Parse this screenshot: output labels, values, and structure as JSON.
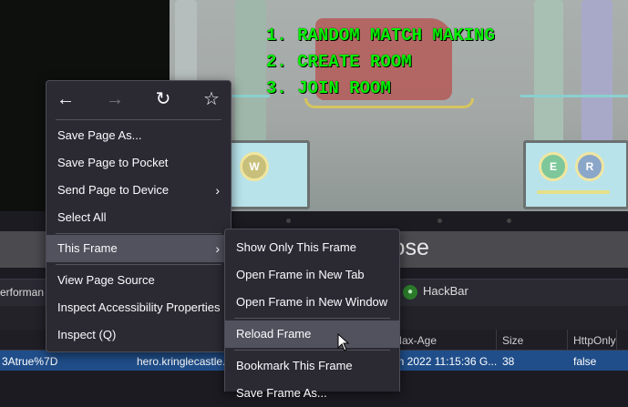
{
  "game": {
    "menu": [
      "1. RANDOM MATCH MAKING",
      "2. CREATE ROOM",
      "3. JOIN ROOM"
    ],
    "left_console": {
      "button": "W"
    },
    "right_console": {
      "buttons": [
        "E",
        "R"
      ]
    }
  },
  "page": {
    "partial_heading": "lose"
  },
  "devtools": {
    "partial_tab": "erforman",
    "addon_tab": "HackBar",
    "addon_icon": "hackbar-icon",
    "columns": [
      "Max-Age",
      "Size",
      "HttpOnly"
    ],
    "row": {
      "value": "3Atrue%7D",
      "domain": "hero.kringlecastle.",
      "expires": "on 2022 11:15:36 G...",
      "size": "38",
      "httponly": "false"
    }
  },
  "context_menu": {
    "nav": {
      "back": "←",
      "forward": "→",
      "reload": "↻",
      "bookmark": "☆"
    },
    "items": [
      "Save Page As...",
      "Save Page to Pocket",
      "Send Page to Device",
      "Select All",
      "This Frame",
      "View Page Source",
      "Inspect Accessibility Properties",
      "Inspect (Q)"
    ],
    "submenu_arrow": "›"
  },
  "frame_submenu": {
    "items": [
      "Show Only This Frame",
      "Open Frame in New Tab",
      "Open Frame in New Window",
      "Reload Frame",
      "Bookmark This Frame",
      "Save Frame As..."
    ]
  },
  "colors": {
    "menu_bg": "#2b2a33",
    "menu_highlight": "#52525e",
    "game_text": "#00f000",
    "selected_row": "#204e8a"
  }
}
